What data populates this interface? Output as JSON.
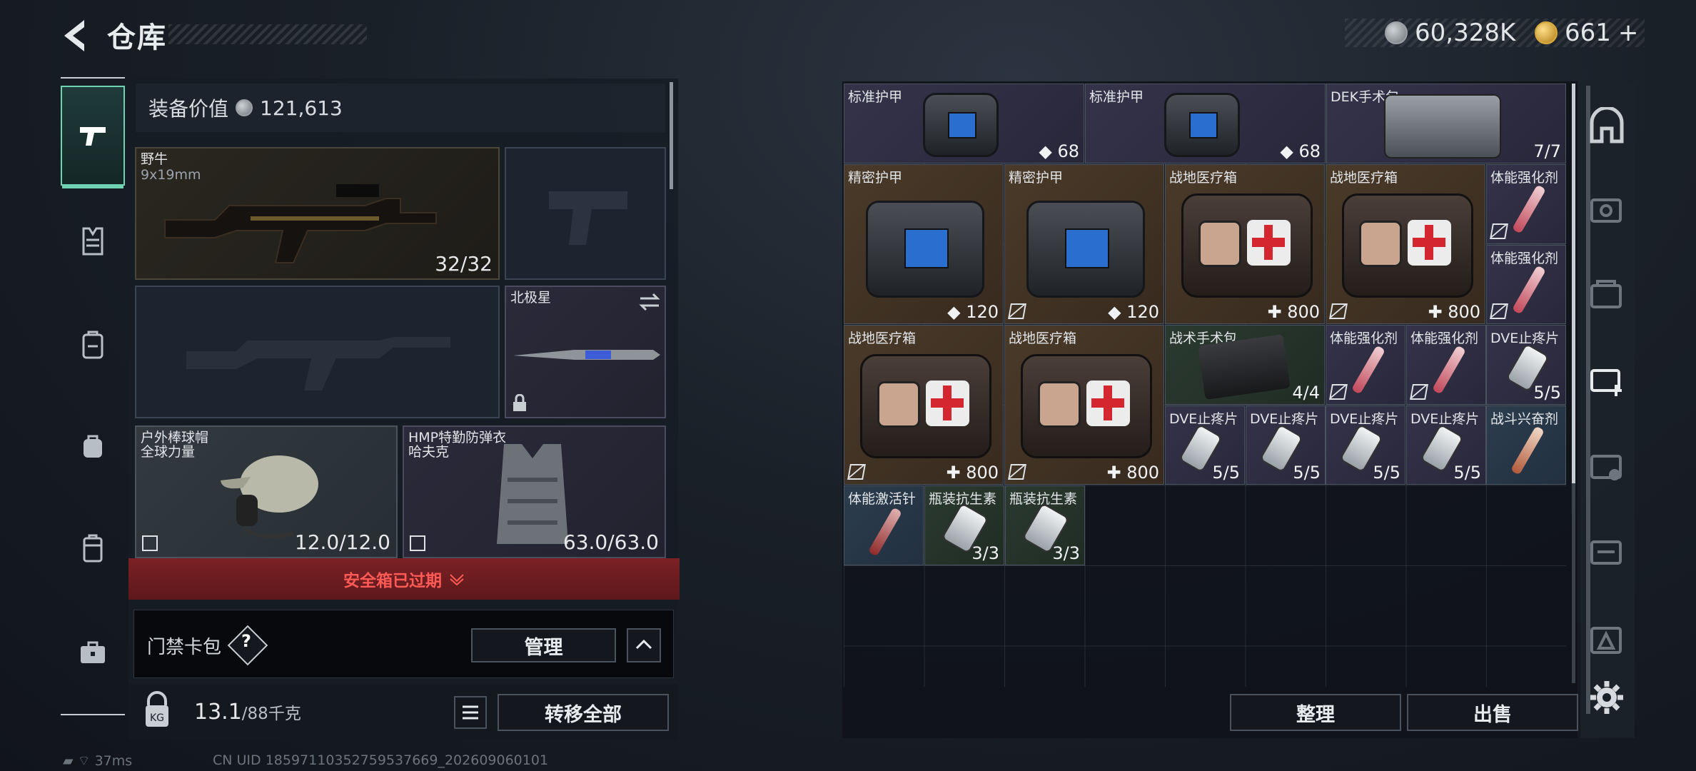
{
  "header": {
    "title": "仓库",
    "currency_silver": "60,328K",
    "currency_gold": "661",
    "gold_plus": "+"
  },
  "left_nav": {
    "tabs": [
      "weapon-icon",
      "vest-icon",
      "backpack-icon",
      "bag-icon",
      "pouch-icon",
      "case-icon"
    ]
  },
  "equipment": {
    "value_label": "装备价值",
    "value": "121,613",
    "primary_weapon": {
      "name": "野牛",
      "caliber": "9x19mm",
      "ammo": "32/32"
    },
    "melee": {
      "name": "北极星"
    },
    "helmet": {
      "name": "户外棒球帽",
      "brand": "全球力量",
      "durability": "12.0/12.0"
    },
    "armor": {
      "name": "HMP特勤防弹衣",
      "brand": "哈夫克",
      "durability": "63.0/63.0"
    }
  },
  "safebox": {
    "expired_label": "安全箱已过期"
  },
  "keycard": {
    "label": "门禁卡包",
    "help": "?",
    "manage_label": "管理"
  },
  "footer": {
    "weight": "13.1",
    "weight_max": "/88千克",
    "transfer_label": "转移全部"
  },
  "status_bar": {
    "ping": "37ms",
    "uid": "CN UID 185971103527595376​69_202609060101"
  },
  "stash": {
    "items": [
      {
        "name": "标准护甲",
        "count": "68"
      },
      {
        "name": "标准护甲",
        "count": "68"
      },
      {
        "name": "DEK手术包",
        "count": "7/7"
      },
      {
        "name": "精密护甲",
        "count": "120"
      },
      {
        "name": "精密护甲",
        "count": "120"
      },
      {
        "name": "战地医疗箱",
        "count": "800"
      },
      {
        "name": "战地医疗箱",
        "count": "800"
      },
      {
        "name": "体能强化剂",
        "count": ""
      },
      {
        "name": "体能强化剂",
        "count": ""
      },
      {
        "name": "战地医疗箱",
        "count": "800"
      },
      {
        "name": "战地医疗箱",
        "count": "800"
      },
      {
        "name": "战术手术包",
        "count": "4/4"
      },
      {
        "name": "体能强化剂",
        "count": ""
      },
      {
        "name": "体能强化剂",
        "count": ""
      },
      {
        "name": "DVE止疼片",
        "count": "5/5"
      },
      {
        "name": "DVE止疼片",
        "count": "5/5"
      },
      {
        "name": "DVE止疼片",
        "count": "5/5"
      },
      {
        "name": "DVE止疼片",
        "count": "5/5"
      },
      {
        "name": "DVE止疼片",
        "count": "5/5"
      },
      {
        "name": "战斗兴奋剂",
        "count": ""
      },
      {
        "name": "体能激活针",
        "count": ""
      },
      {
        "name": "瓶装抗生素",
        "count": "3/3"
      },
      {
        "name": "瓶装抗生素",
        "count": "3/3"
      }
    ],
    "sort_label": "整理",
    "sell_label": "出售"
  },
  "colors": {
    "accent": "#6fd3b3",
    "warning_red": "#ff5a55",
    "gold": "#d8a83a"
  }
}
